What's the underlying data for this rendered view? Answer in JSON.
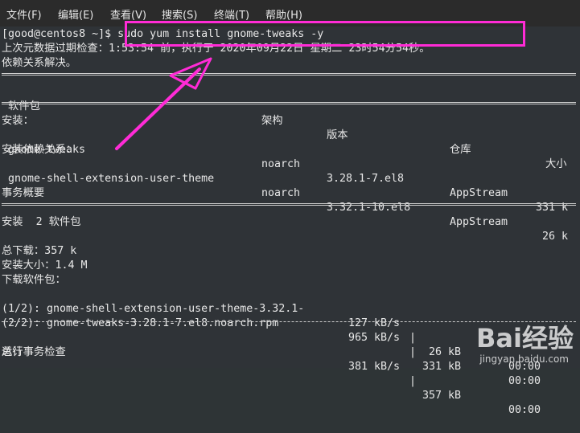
{
  "menubar": {
    "items": [
      "文件(F)",
      "编辑(E)",
      "查看(V)",
      "搜索(S)",
      "终端(T)",
      "帮助(H)"
    ]
  },
  "terminal": {
    "prompt": "[good@centos8 ~]$",
    "command": " sudo yum install gnome-tweaks -y",
    "meta_line": "上次元数据过期检查：1:53:54 前，执行于 2020年09月22日 星期二 23时54分54秒。",
    "deps_resolved": "依赖关系解决。",
    "table": {
      "headers": [
        "软件包",
        "架构",
        "版本",
        "仓库",
        "大小"
      ],
      "installing_label": "安装：",
      "deps_label": "安装依赖关系：",
      "rows": [
        [
          "gnome-tweaks",
          "noarch",
          "3.28.1-7.el8",
          "AppStream",
          "331 k"
        ],
        [
          "gnome-shell-extension-user-theme",
          "noarch",
          "3.32.1-10.el8",
          "AppStream",
          "26 k"
        ]
      ]
    },
    "summary_title": "事务概要",
    "install_count": "安装  2 软件包",
    "total_download": "总下载：357 k",
    "install_size": "安装大小：1.4 M",
    "downloading": "下载软件包：",
    "downloads": [
      {
        "file": "(1/2): gnome-shell-extension-user-theme-3.32.1-",
        "speed": "127 kB/s",
        "size": " 26 kB",
        "time": "00:00"
      },
      {
        "file": "(2/2): gnome-tweaks-3.28.1-7.el8.noarch.rpm",
        "speed": "965 kB/s",
        "size": "331 kB",
        "time": "00:00"
      }
    ],
    "total_label": "总计",
    "total_speed": "381 kB/s",
    "total_size": "357 kB",
    "total_time": "00:00",
    "last_line": "运行事务检查"
  },
  "watermark": {
    "logo": "Bai经验",
    "url": "jingyan.baidu.com"
  },
  "colors": {
    "highlight": "#ff2bd6",
    "terminal_bg": "#2f3337",
    "menubar_bg": "#2b2b2b",
    "text": "#e8e8e8"
  }
}
